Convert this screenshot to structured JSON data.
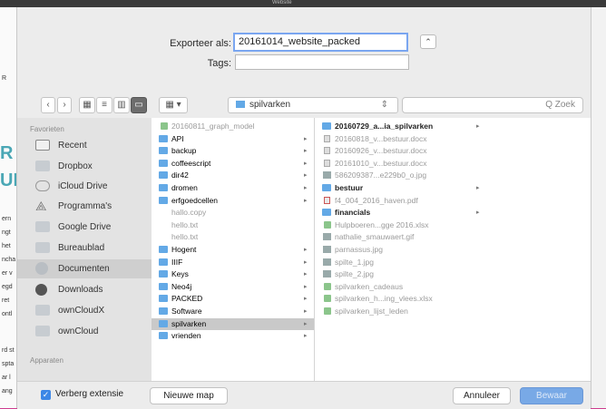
{
  "dialog": {
    "export_label": "Exporteer als:",
    "export_value": "20161014_website_packed",
    "tags_label": "Tags:",
    "tags_value": "",
    "expand_icon": "chevron-up-icon"
  },
  "toolbar": {
    "back": "‹",
    "forward": "›",
    "view_icons": "▦",
    "view_list": "≡",
    "view_columns": "▥",
    "view_gallery": "▭",
    "group": "▦ ▾",
    "location": "spilvarken",
    "location_arrows": "⇕",
    "search_placeholder": "Q Zoek"
  },
  "sidebar": {
    "favorites_heading": "Favorieten",
    "devices_heading": "Apparaten",
    "items": [
      {
        "label": "Recent",
        "icon": "clock-icon"
      },
      {
        "label": "Dropbox",
        "icon": "folder-icon"
      },
      {
        "label": "iCloud Drive",
        "icon": "cloud-icon"
      },
      {
        "label": "Programma's",
        "icon": "apps-icon"
      },
      {
        "label": "Google Drive",
        "icon": "folder-icon"
      },
      {
        "label": "Bureaublad",
        "icon": "folder-icon"
      },
      {
        "label": "Documenten",
        "icon": "documents-icon"
      },
      {
        "label": "Downloads",
        "icon": "download-icon"
      },
      {
        "label": "ownCloudX",
        "icon": "folder-icon"
      },
      {
        "label": "ownCloud",
        "icon": "folder-icon"
      }
    ]
  },
  "column1": {
    "items": [
      {
        "label": "20160811_graph_model",
        "type": "file-green",
        "dim": true,
        "arrow": false
      },
      {
        "label": "API",
        "type": "folder",
        "dim": false,
        "arrow": true
      },
      {
        "label": "backup",
        "type": "folder",
        "dim": false,
        "arrow": true
      },
      {
        "label": "coffeescript",
        "type": "folder",
        "dim": false,
        "arrow": true
      },
      {
        "label": "dir42",
        "type": "folder",
        "dim": false,
        "arrow": true
      },
      {
        "label": "dromen",
        "type": "folder",
        "dim": false,
        "arrow": true
      },
      {
        "label": "erfgoedcellen",
        "type": "folder",
        "dim": false,
        "arrow": true
      },
      {
        "label": "hallo.copy",
        "type": "none",
        "dim": true,
        "arrow": false
      },
      {
        "label": "hello.txt",
        "type": "none",
        "dim": true,
        "arrow": false
      },
      {
        "label": "hello.txt",
        "type": "none",
        "dim": true,
        "arrow": false
      },
      {
        "label": "Hogent",
        "type": "folder",
        "dim": false,
        "arrow": true
      },
      {
        "label": "IIIF",
        "type": "folder",
        "dim": false,
        "arrow": true
      },
      {
        "label": "Keys",
        "type": "folder",
        "dim": false,
        "arrow": true
      },
      {
        "label": "Neo4j",
        "type": "folder",
        "dim": false,
        "arrow": true
      },
      {
        "label": "PACKED",
        "type": "folder",
        "dim": false,
        "arrow": true
      },
      {
        "label": "Software",
        "type": "folder",
        "dim": false,
        "arrow": true
      },
      {
        "label": "spilvarken",
        "type": "folder",
        "dim": false,
        "arrow": true,
        "selected": true
      },
      {
        "label": "vrienden",
        "type": "folder",
        "dim": false,
        "arrow": true
      }
    ]
  },
  "column2": {
    "items": [
      {
        "label": "20160729_a...ia_spilvarken",
        "type": "folder",
        "bold": true,
        "arrow": true
      },
      {
        "label": "20160818_v...bestuur.docx",
        "type": "file",
        "dim": true
      },
      {
        "label": "20160926_v...bestuur.docx",
        "type": "file",
        "dim": true
      },
      {
        "label": "20161010_v...bestuur.docx",
        "type": "file",
        "dim": true
      },
      {
        "label": "586209387...e229b0_o.jpg",
        "type": "file-img",
        "dim": true
      },
      {
        "label": "bestuur",
        "type": "folder",
        "bold": true,
        "arrow": true
      },
      {
        "label": "f4_004_2016_haven.pdf",
        "type": "file-pdf",
        "dim": true
      },
      {
        "label": "financials",
        "type": "folder",
        "bold": true,
        "arrow": true
      },
      {
        "label": "Hulpboeren...gge 2016.xlsx",
        "type": "file-green",
        "dim": true
      },
      {
        "label": "nathalie_smauwaert.gif",
        "type": "file-img",
        "dim": true
      },
      {
        "label": "parnassus.jpg",
        "type": "file-img",
        "dim": true
      },
      {
        "label": "spilte_1.jpg",
        "type": "file-img",
        "dim": true
      },
      {
        "label": "spilte_2.jpg",
        "type": "file-img",
        "dim": true
      },
      {
        "label": "spilvarken_cadeaus",
        "type": "file-green",
        "dim": true
      },
      {
        "label": "spilvarken_h...ing_vlees.xlsx",
        "type": "file-green",
        "dim": true
      },
      {
        "label": "spilvarken_lijst_leden",
        "type": "file-green",
        "dim": true
      }
    ]
  },
  "bottom": {
    "hide_extension_label": "Verberg extensie",
    "new_folder_label": "Nieuwe map",
    "cancel_label": "Annuleer",
    "save_label": "Bewaar"
  },
  "background": {
    "window_title": "Website",
    "fragments": [
      "R",
      "UR",
      "ern",
      "ngt",
      "het",
      "ncha",
      "er v",
      "egd",
      "ret",
      "ontl",
      "rd st",
      "spta",
      "ar l",
      "ang"
    ]
  },
  "colors": {
    "accent": "#3d87e6",
    "folder": "#63a9e6",
    "frame": "#cd3b8e"
  }
}
